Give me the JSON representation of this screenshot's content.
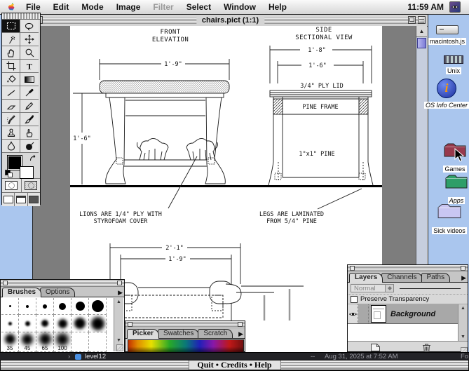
{
  "menu_bar": {
    "items": [
      {
        "label": "File",
        "enabled": true
      },
      {
        "label": "Edit",
        "enabled": true
      },
      {
        "label": "Mode",
        "enabled": true
      },
      {
        "label": "Image",
        "enabled": true
      },
      {
        "label": "Filter",
        "enabled": false
      },
      {
        "label": "Select",
        "enabled": true
      },
      {
        "label": "Window",
        "enabled": true
      },
      {
        "label": "Help",
        "enabled": true
      }
    ],
    "clock": "11:59 AM"
  },
  "window": {
    "title": "chairs.pict (1:1)"
  },
  "drawing": {
    "front": {
      "title1": "FRONT",
      "title2": "ELEVATION",
      "width_dim": "1'-9\"",
      "height_dim": "1'-6\""
    },
    "side": {
      "title1": "SIDE",
      "title2": "SECTIONAL VIEW",
      "outer_dim": "1'-8\"",
      "inner_dim": "1'-6\"",
      "lid_label": "3/4\" PLY LID",
      "frame_label": "PINE FRAME",
      "pine_label": "1\"x1\" PINE"
    },
    "plan": {
      "outer_dim": "2'-1\"",
      "inner_dim": "1'-9\""
    },
    "notes": {
      "lions1": "LIONS ARE 1/4\" PLY WITH",
      "lions2": "STYROFOAM COVER",
      "legs1": "LEGS ARE LAMINATED",
      "legs2": "FROM 5/4\" PINE"
    }
  },
  "toolbox": {
    "tools": [
      "Rectangular Marquee",
      "Lasso",
      "Magic Wand",
      "Move",
      "Hand",
      "Zoom",
      "Crop",
      "Type",
      "Paint Bucket",
      "Gradient",
      "Line",
      "Eyedropper",
      "Eraser",
      "Pencil",
      "Airbrush",
      "Paintbrush",
      "Rubber Stamp",
      "Smudge",
      "Blur",
      "Toning"
    ]
  },
  "brushes": {
    "tabs": [
      "Brushes",
      "Options"
    ],
    "sizes": [
      "35",
      "45",
      "65",
      "100"
    ]
  },
  "picker": {
    "tabs": [
      "Picker",
      "Swatches",
      "Scratch"
    ]
  },
  "layers": {
    "tabs": [
      "Layers",
      "Channels",
      "Paths"
    ],
    "blend_mode": "Normal",
    "preserve_label": "Preserve Transparency",
    "layer_name": "Background"
  },
  "desktop_icons": [
    {
      "label": "macintosh.js"
    },
    {
      "label": "Unix"
    },
    {
      "label": "OS Info Center"
    },
    {
      "label": "Games"
    },
    {
      "label": "Apps"
    },
    {
      "label": "Sick videos"
    }
  ],
  "finder_row": {
    "name": "level12",
    "dashes": "--",
    "date": "Aug 31, 2025 at 7:52 AM",
    "kind": "Fo"
  },
  "footer": {
    "label": "Quit • Credits • Help"
  },
  "glyphs": {
    "menu_arrow": "▶",
    "up": "▲",
    "down": "▼",
    "chevron": "›",
    "type_tool": "T",
    "info_i": "i"
  },
  "colors": {
    "desktop": "#aac6ee",
    "scroll_thumb": "#7b7bd6",
    "games_folder": "#97394c",
    "apps_folder": "#2e9e68",
    "videos_folder": "#c9c6f2",
    "info_blue": "#2244cc"
  }
}
